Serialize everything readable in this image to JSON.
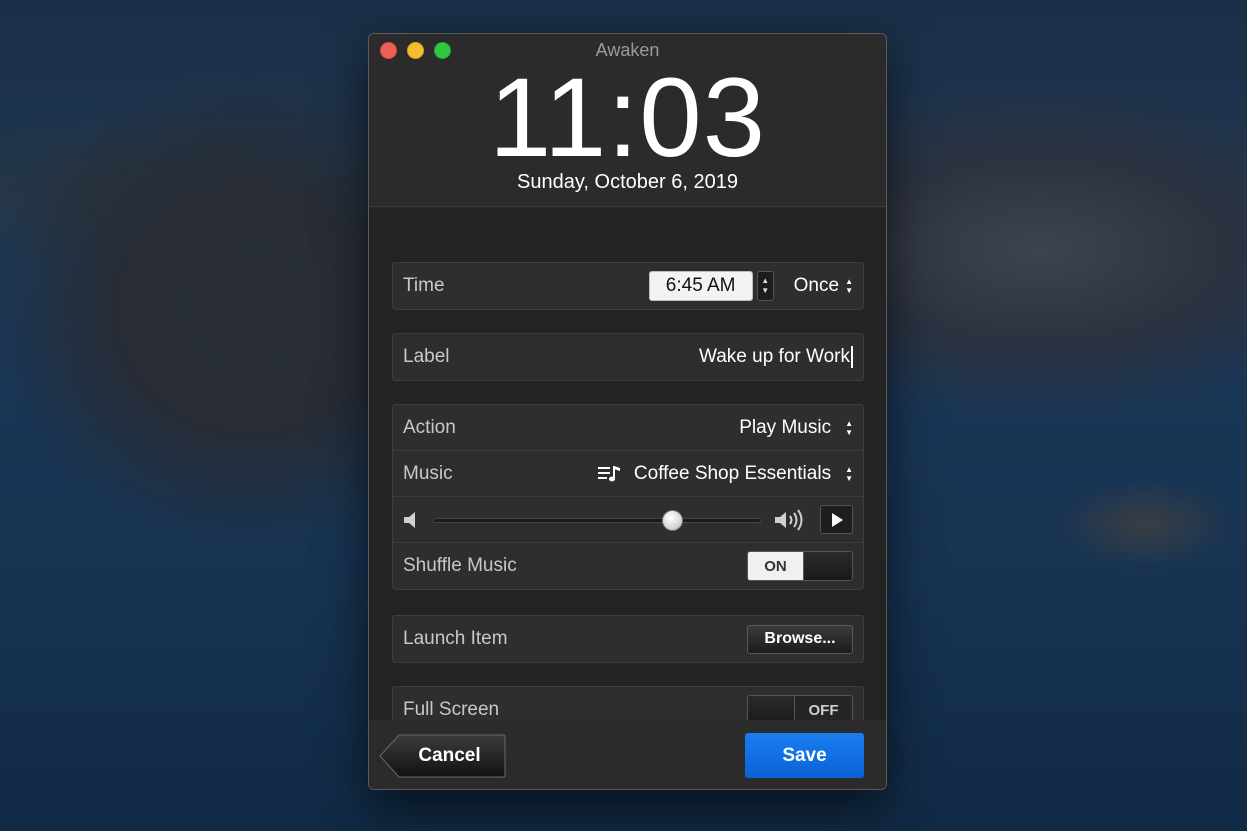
{
  "window": {
    "title": "Awaken",
    "clock": "11:03",
    "date": "Sunday, October 6, 2019"
  },
  "time_row": {
    "label": "Time",
    "value": "6:45 AM",
    "repeat": "Once"
  },
  "label_row": {
    "label": "Label",
    "value": "Wake up for Work"
  },
  "action_row": {
    "label": "Action",
    "value": "Play Music"
  },
  "music_row": {
    "label": "Music",
    "value": "Coffee Shop Essentials",
    "icon": "playlist-icon"
  },
  "volume": {
    "level": 0.73,
    "min_icon": "speaker-low-icon",
    "max_icon": "speaker-high-icon",
    "play_icon": "play-icon"
  },
  "shuffle_row": {
    "label": "Shuffle Music",
    "toggle_text": "ON",
    "state": true
  },
  "launch_row": {
    "label": "Launch Item",
    "button": "Browse..."
  },
  "fullscreen_row": {
    "label": "Full Screen",
    "toggle_text": "OFF",
    "state": false
  },
  "footer": {
    "cancel": "Cancel",
    "save": "Save"
  },
  "colors": {
    "save_button": "#0a66d8",
    "close": "#ed5f56",
    "minimize": "#f5bc2f",
    "maximize": "#2fc840"
  }
}
